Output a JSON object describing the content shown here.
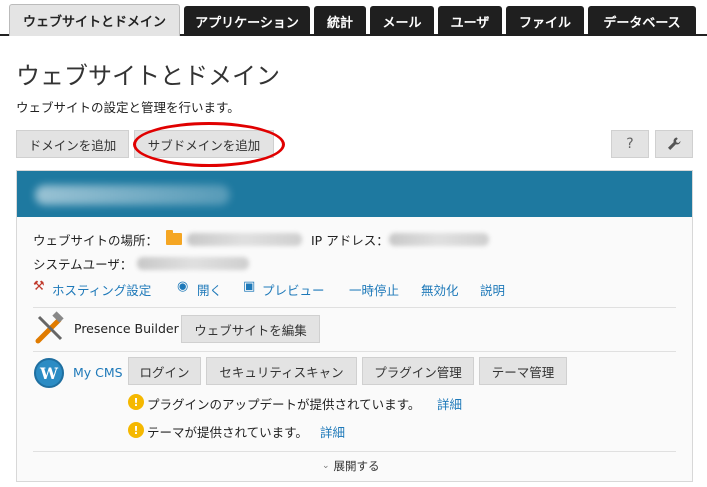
{
  "nav": {
    "tabs": [
      {
        "label": "ウェブサイトとドメイン",
        "active": true
      },
      {
        "label": "アプリケーション",
        "active": false
      },
      {
        "label": "統計",
        "active": false
      },
      {
        "label": "メール",
        "active": false
      },
      {
        "label": "ユーザ",
        "active": false
      },
      {
        "label": "ファイル",
        "active": false
      },
      {
        "label": "データベース",
        "active": false
      }
    ]
  },
  "page": {
    "title": "ウェブサイトとドメイン",
    "description": "ウェブサイトの設定と管理を行います。"
  },
  "toolbar": {
    "add_domain": "ドメインを追加",
    "add_subdomain": "サブドメインを追加",
    "help": "?",
    "settings_icon": "wrench-icon"
  },
  "domain": {
    "location_label": "ウェブサイトの場所：",
    "ip_label": "IP アドレス：",
    "system_user_label": "システムユーザ：",
    "actions": {
      "hosting": "ホスティング設定",
      "open": "開く",
      "preview": "プレビュー",
      "suspend": "一時停止",
      "disable": "無効化",
      "description": "説明"
    },
    "presence_builder": {
      "label": "Presence Builder",
      "edit_button": "ウェブサイトを編集"
    },
    "cms": {
      "label": "My CMS",
      "buttons": [
        "ログイン",
        "セキュリティスキャン",
        "プラグイン管理",
        "テーマ管理"
      ],
      "notices": [
        {
          "text": "プラグインのアップデートが提供されています。",
          "link": "詳細"
        },
        {
          "text": "テーマが提供されています。",
          "link": "詳細"
        }
      ]
    },
    "expand": "展開する"
  },
  "colors": {
    "accent": "#1e79a0",
    "link": "#1e79b9",
    "highlight": "#e00000",
    "warning": "#f5b800"
  }
}
